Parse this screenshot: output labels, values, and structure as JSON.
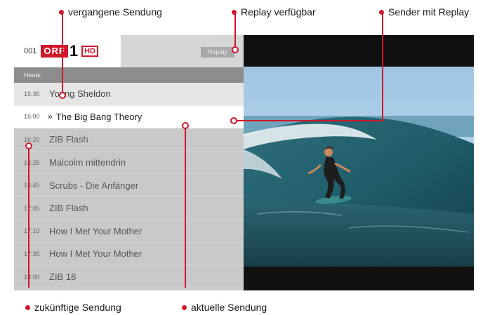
{
  "callouts": {
    "past": "vergangene Sendung",
    "replay_available": "Replay verfügbar",
    "channel_replay": "Sender mit Replay",
    "future": "zukünftige Sendung",
    "current": "aktuelle Sendung"
  },
  "channel": {
    "number": "001",
    "logo_text": "ORF",
    "logo_digit": "1",
    "hd": "HD",
    "replay_label": "Replay"
  },
  "date_label": "Heute",
  "programs": [
    {
      "time": "15:35",
      "title": "Young Sheldon",
      "state": "past"
    },
    {
      "time": "16:00",
      "title": "The Big Bang Theory",
      "state": "current"
    },
    {
      "time": "16:20",
      "title": "ZIB Flash",
      "state": "future"
    },
    {
      "time": "16:25",
      "title": "Malcolm mittendrin",
      "state": "future"
    },
    {
      "time": "16:45",
      "title": "Scrubs - Die Anfänger",
      "state": "future"
    },
    {
      "time": "17:05",
      "title": "ZIB Flash",
      "state": "future"
    },
    {
      "time": "17:10",
      "title": "How I Met Your Mother",
      "state": "future"
    },
    {
      "time": "17:35",
      "title": "How I Met Your Mother",
      "state": "future"
    },
    {
      "time": "18:00",
      "title": "ZIB 18",
      "state": "future"
    }
  ],
  "colors": {
    "accent": "#d0172b",
    "panel": "#c9c9c9",
    "date_bar": "#8d8d8d"
  }
}
